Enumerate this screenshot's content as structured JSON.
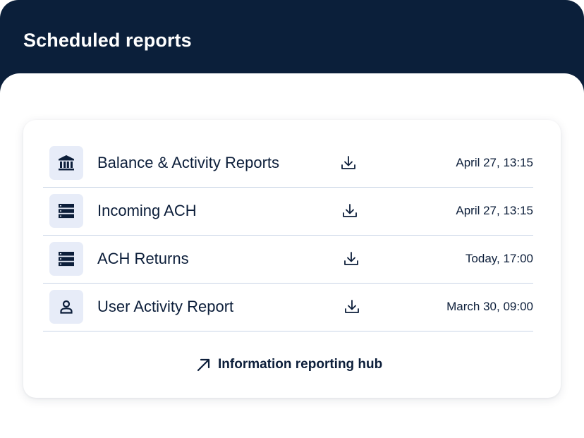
{
  "header": {
    "title": "Scheduled reports"
  },
  "reports": [
    {
      "label": "Balance & Activity Reports",
      "time": "April 27, 13:15",
      "icon": "bank-icon"
    },
    {
      "label": "Incoming ACH",
      "time": "April 27, 13:15",
      "icon": "server-icon"
    },
    {
      "label": "ACH Returns",
      "time": "Today, 17:00",
      "icon": "server-icon"
    },
    {
      "label": "User Activity Report",
      "time": "March 30, 09:00",
      "icon": "user-icon"
    }
  ],
  "hub_link": {
    "label": "Information reporting hub",
    "icon": "arrow-up-right-icon"
  },
  "colors": {
    "header_bg": "#0b1f3a",
    "icon_bg": "#e7ecf8",
    "text": "#0c1e3a",
    "divider": "#c9d4e6"
  }
}
